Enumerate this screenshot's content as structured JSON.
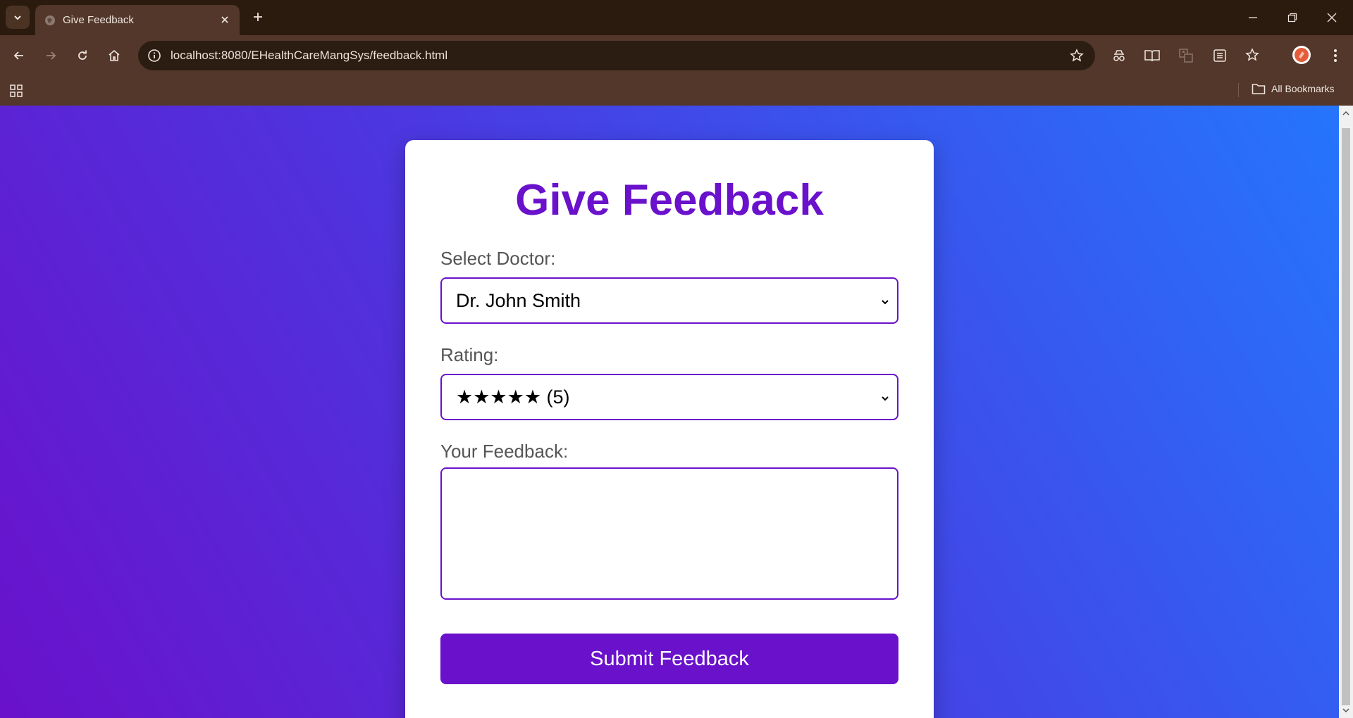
{
  "browser": {
    "tab_title": "Give Feedback",
    "url": "localhost:8080/EHealthCareMangSys/feedback.html",
    "bookmarks_label": "All Bookmarks"
  },
  "page": {
    "title": "Give Feedback",
    "doctor_label": "Select Doctor:",
    "doctor_selected": "Dr. John Smith",
    "rating_label": "Rating:",
    "rating_selected": "★★★★★ (5)",
    "feedback_label": "Your Feedback:",
    "feedback_value": "",
    "submit_label": "Submit Feedback"
  },
  "colors": {
    "accent": "#6a11cb",
    "gradient_start": "#6a11cb",
    "gradient_end": "#2575fc",
    "chrome_dark": "#2b1a0e",
    "chrome_toolbar": "#53372a"
  }
}
